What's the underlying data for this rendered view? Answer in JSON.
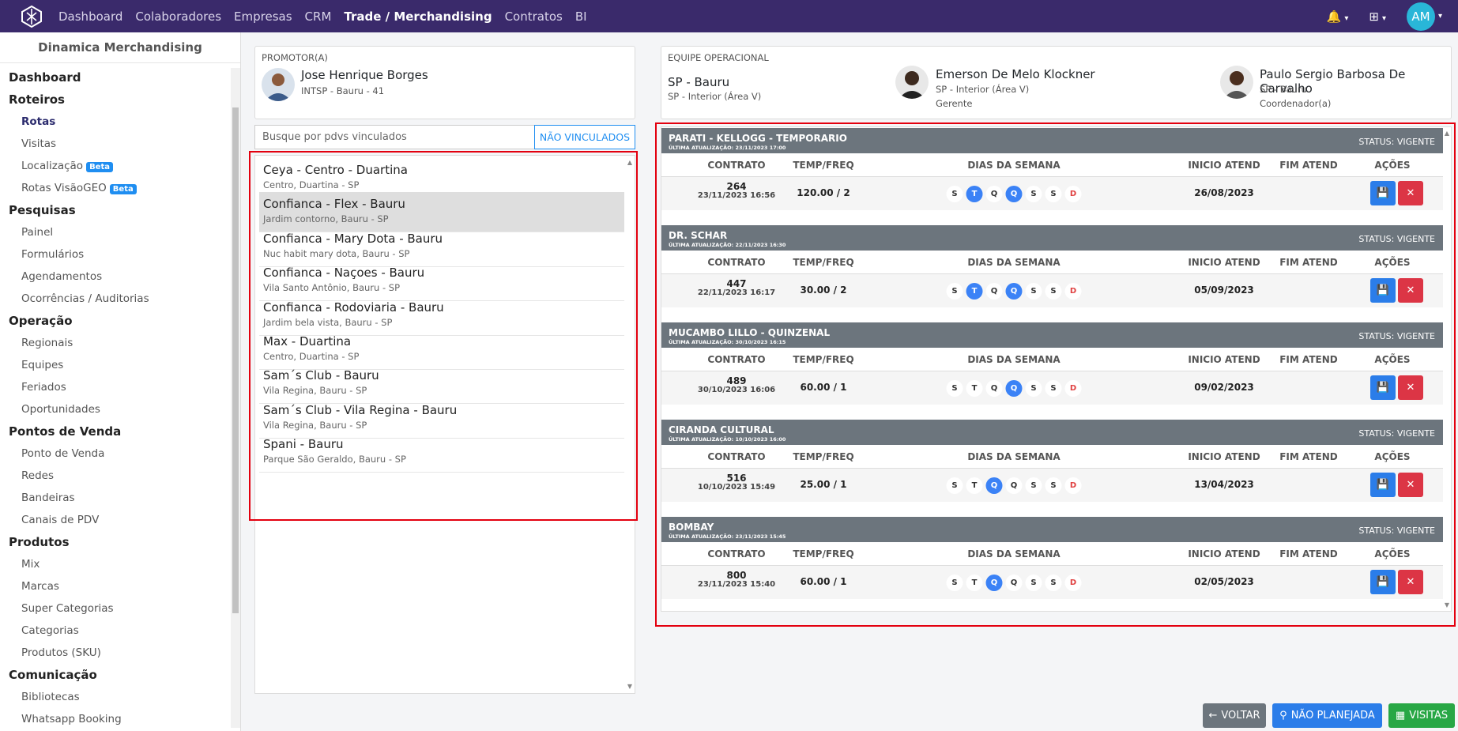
{
  "nav": {
    "links": [
      "Dashboard",
      "Colaboradores",
      "Empresas",
      "CRM",
      "Trade / Merchandising",
      "Contratos",
      "BI"
    ],
    "active_index": 4,
    "avatar_initials": "AM"
  },
  "sidebar": {
    "title": "Dinamica Merchandising",
    "groups": [
      {
        "label": "Dashboard",
        "items": []
      },
      {
        "label": "Roteiros",
        "items": [
          "Rotas",
          "Visitas",
          "Localização",
          "Rotas VisãoGEO"
        ]
      },
      {
        "label": "Pesquisas",
        "items": [
          "Painel",
          "Formulários",
          "Agendamentos",
          "Ocorrências / Auditorias"
        ]
      },
      {
        "label": "Operação",
        "items": [
          "Regionais",
          "Equipes",
          "Feriados",
          "Oportunidades"
        ]
      },
      {
        "label": "Pontos de Venda",
        "items": [
          "Ponto de Venda",
          "Redes",
          "Bandeiras",
          "Canais de PDV"
        ]
      },
      {
        "label": "Produtos",
        "items": [
          "Mix",
          "Marcas",
          "Super Categorias",
          "Categorias",
          "Produtos (SKU)"
        ]
      },
      {
        "label": "Comunicação",
        "items": [
          "Bibliotecas",
          "Whatsapp Booking"
        ]
      }
    ],
    "active_item": "Rotas",
    "beta_label": "Beta",
    "beta_items": [
      "Localização",
      "Rotas VisãoGEO"
    ]
  },
  "promotor": {
    "label": "PROMOTOR(A)",
    "name": "Jose Henrique Borges",
    "detail": "INTSP - Bauru - 41"
  },
  "equipe": {
    "label": "EQUIPE OPERACIONAL",
    "team": "SP - Bauru",
    "team_region": "SP - Interior (Área V)",
    "members": [
      {
        "name": "Emerson De Melo Klockner",
        "region": "SP - Interior (Área V)",
        "role": "Gerente"
      },
      {
        "name": "Paulo Sergio Barbosa De Carvalho",
        "region": "SP - Bauru",
        "role": "Coordenador(a)"
      }
    ]
  },
  "search": {
    "placeholder": "Busque por pdvs vinculados",
    "button": "NÃO VINCULADOS"
  },
  "pdvs": [
    {
      "name": "Ceya - Centro - Duartina",
      "address": "Centro, Duartina - SP"
    },
    {
      "name": "Confianca - Flex - Bauru",
      "address": "Jardim contorno, Bauru - SP"
    },
    {
      "name": "Confianca - Mary Dota - Bauru",
      "address": "Nuc habit mary dota, Bauru - SP"
    },
    {
      "name": "Confianca - Naçoes - Bauru",
      "address": "Vila Santo Antônio, Bauru - SP"
    },
    {
      "name": "Confianca - Rodoviaria - Bauru",
      "address": "Jardim bela vista, Bauru - SP"
    },
    {
      "name": "Max - Duartina",
      "address": "Centro, Duartina - SP"
    },
    {
      "name": "Sam´s Club - Bauru",
      "address": "Vila Regina, Bauru - SP"
    },
    {
      "name": "Sam´s Club - Vila Regina - Bauru",
      "address": "Vila Regina, Bauru - SP"
    },
    {
      "name": "Spani - Bauru",
      "address": "Parque São Geraldo, Bauru - SP"
    }
  ],
  "selected_pdv_index": 1,
  "columns": [
    "CONTRATO",
    "TEMP/FREQ",
    "DIAS DA SEMANA",
    "INICIO ATEND",
    "FIM ATEND",
    "AÇÕES"
  ],
  "day_letters": [
    "S",
    "T",
    "Q",
    "Q",
    "S",
    "S",
    "D"
  ],
  "contracts": [
    {
      "title": "PARATI - KELLOGG - TEMPORARIO",
      "updated": "ÚLTIMA ATUALIZAÇÃO: 23/11/2023 17:00",
      "status": "STATUS: VIGENTE",
      "number": "264",
      "date": "23/11/2023 16:56",
      "freq": "120.00 / 2",
      "active_days": [
        1,
        3
      ],
      "start": "26/08/2023",
      "end": ""
    },
    {
      "title": "DR. SCHAR",
      "updated": "ÚLTIMA ATUALIZAÇÃO: 22/11/2023 16:30",
      "status": "STATUS: VIGENTE",
      "number": "447",
      "date": "22/11/2023 16:17",
      "freq": "30.00 / 2",
      "active_days": [
        1,
        3
      ],
      "start": "05/09/2023",
      "end": ""
    },
    {
      "title": "MUCAMBO LILLO - QUINZENAL",
      "updated": "ÚLTIMA ATUALIZAÇÃO: 30/10/2023 16:15",
      "status": "STATUS: VIGENTE",
      "number": "489",
      "date": "30/10/2023 16:06",
      "freq": "60.00 / 1",
      "active_days": [
        3
      ],
      "start": "09/02/2023",
      "end": ""
    },
    {
      "title": "CIRANDA CULTURAL",
      "updated": "ÚLTIMA ATUALIZAÇÃO: 10/10/2023 16:00",
      "status": "STATUS: VIGENTE",
      "number": "516",
      "date": "10/10/2023 15:49",
      "freq": "25.00 / 1",
      "active_days": [
        2
      ],
      "start": "13/04/2023",
      "end": ""
    },
    {
      "title": "BOMBAY",
      "updated": "ÚLTIMA ATUALIZAÇÃO: 23/11/2023 15:45",
      "status": "STATUS: VIGENTE",
      "number": "800",
      "date": "23/11/2023 15:40",
      "freq": "60.00 / 1",
      "active_days": [
        2
      ],
      "start": "02/05/2023",
      "end": ""
    }
  ],
  "footer": {
    "voltar": "VOLTAR",
    "nao_planejada": "NÃO PLANEJADA",
    "visitas": "VISITAS"
  },
  "colors": {
    "nav_bg": "#3a2a6b",
    "primary": "#2b7de9",
    "danger": "#dc3545",
    "success": "#28a745",
    "header_gray": "#6c757d",
    "highlight_red": "#e3000f"
  }
}
